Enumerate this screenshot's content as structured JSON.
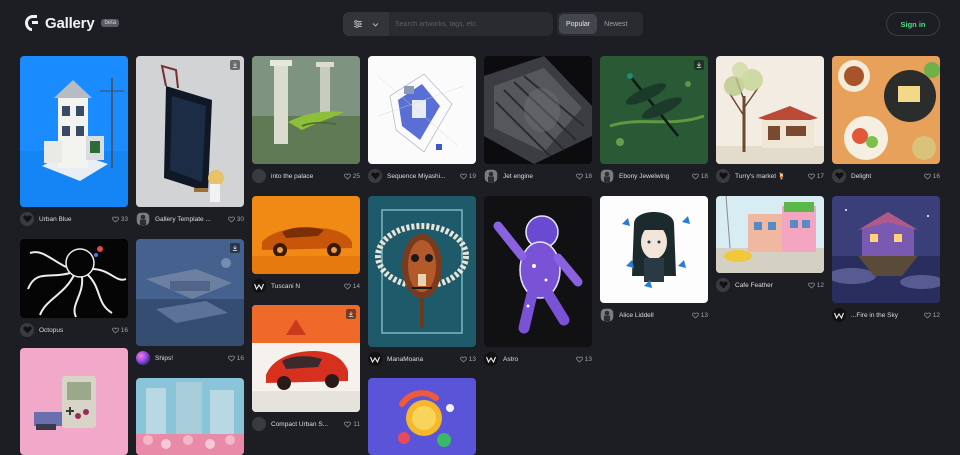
{
  "header": {
    "logo_text": "Gallery",
    "logo_badge": "beta",
    "search_placeholder": "Search artworks, tags, etc.",
    "sort_popular": "Popular",
    "sort_newest": "Newest",
    "signin_label": "Sign in"
  },
  "cards": [
    {
      "title": "Urban Blue",
      "likes": "33",
      "avatar": "heart",
      "saved": false
    },
    {
      "title": "Gallery Template ...",
      "likes": "30",
      "avatar": "figure",
      "saved": true
    },
    {
      "title": "into the palace",
      "likes": "25",
      "avatar": "empty",
      "saved": false
    },
    {
      "title": "Sequence Miyashi...",
      "likes": "19",
      "avatar": "heart",
      "saved": false
    },
    {
      "title": "Jet engine",
      "likes": "18",
      "avatar": "figure",
      "saved": false
    },
    {
      "title": "Ebony Jewelwing",
      "likes": "18",
      "avatar": "figure",
      "saved": true
    },
    {
      "title": "Turry's market 🍹",
      "likes": "17",
      "avatar": "heart",
      "saved": false
    },
    {
      "title": "Delight",
      "likes": "16",
      "avatar": "heart",
      "saved": false
    },
    {
      "title": "Octopus",
      "likes": "16",
      "avatar": "heart",
      "saved": false
    },
    {
      "title": "Ships!",
      "likes": "16",
      "avatar": "sphere",
      "saved": true
    },
    {
      "title": "Tuscani N",
      "likes": "14",
      "avatar": "wave",
      "saved": false
    },
    {
      "title": "ManaMoana",
      "likes": "13",
      "avatar": "wave",
      "saved": false
    },
    {
      "title": "Astro",
      "likes": "13",
      "avatar": "wave",
      "saved": false
    },
    {
      "title": "Alice Liddell",
      "likes": "13",
      "avatar": "figure",
      "saved": false
    },
    {
      "title": "Cafe Feather",
      "likes": "12",
      "avatar": "heart",
      "saved": false
    },
    {
      "title": "...Fire in the Sky",
      "likes": "12",
      "avatar": "wave",
      "saved": false
    },
    {
      "title": "Compact Urban S...",
      "likes": "11",
      "avatar": "empty",
      "saved": true
    },
    {
      "title": "",
      "likes": "",
      "avatar": "",
      "saved": false
    },
    {
      "title": "",
      "likes": "",
      "avatar": "",
      "saved": false
    },
    {
      "title": "",
      "likes": "",
      "avatar": "",
      "saved": false
    }
  ],
  "colors": {
    "background": "#1d1e23",
    "signin_accent": "#4ade80"
  }
}
